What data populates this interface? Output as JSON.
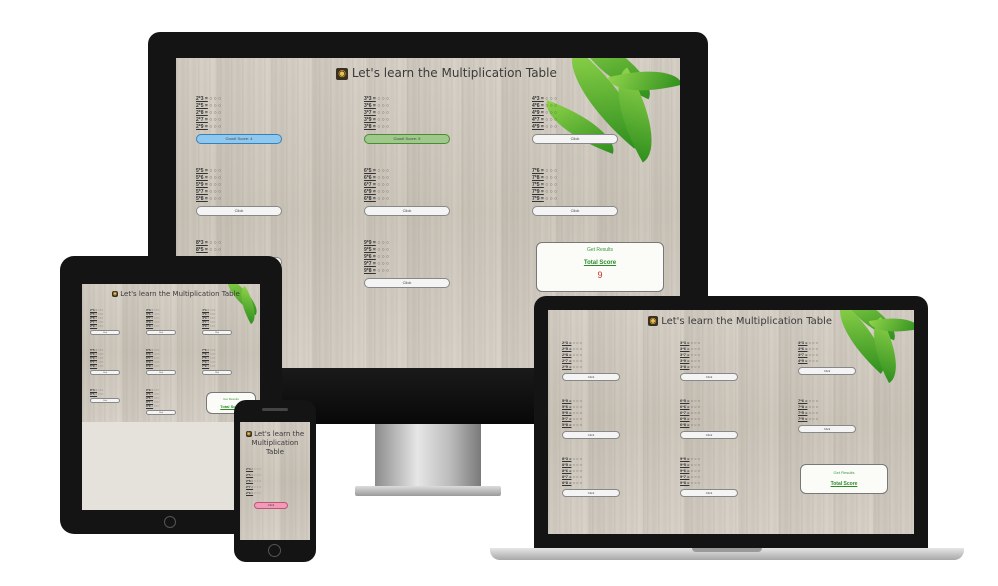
{
  "app": {
    "title": "Let's learn the Multiplication Table",
    "title_icon": "ninja-icon"
  },
  "desktop": {
    "blocks": [
      {
        "rows": [
          "2*3 =",
          "2*5 =",
          "2*8 =",
          "2*7 =",
          "2*9 ="
        ],
        "button": "Good! Score: 4"
      },
      {
        "rows": [
          "3*3 =",
          "3*6 =",
          "3*7 =",
          "3*9 =",
          "3*8 ="
        ],
        "button": "Good! Score: 5"
      },
      {
        "rows": [
          "4*3 =",
          "4*6 =",
          "4*9 =",
          "4*7 =",
          "4*9 ="
        ],
        "button": "Click"
      },
      {
        "rows": [
          "5*5 =",
          "5*6 =",
          "5*9 =",
          "5*7 =",
          "5*8 ="
        ],
        "button": "Click"
      },
      {
        "rows": [
          "6*5 =",
          "6*6 =",
          "6*7 =",
          "6*9 =",
          "6*8 ="
        ],
        "button": "Click"
      },
      {
        "rows": [
          "7*6 =",
          "7*8 =",
          "7*5 =",
          "7*9 =",
          "7*9 ="
        ],
        "button": "Click"
      },
      {
        "rows": [
          "8*3 =",
          "8*5 ="
        ],
        "button": "Click"
      },
      {
        "rows": [
          "9*9 =",
          "9*5 =",
          "9*6 =",
          "9*7 =",
          "9*8 ="
        ],
        "button": "Click"
      }
    ],
    "results": {
      "label": "Get Results",
      "total": "Total Score",
      "score": "9"
    }
  },
  "laptop": {
    "blocks": [
      {
        "rows": [
          "2*3 =",
          "2*5 =",
          "2*8 =",
          "2*7 =",
          "2*9 ="
        ],
        "button": "Click"
      },
      {
        "rows": [
          "3*3 =",
          "3*6 =",
          "3*7 =",
          "3*9 =",
          "3*8 ="
        ],
        "button": "Click"
      },
      {
        "rows": [
          "4*3 =",
          "4*6 =",
          "4*7 =",
          "4*9 ="
        ],
        "button": "Click"
      },
      {
        "rows": [
          "5*5 =",
          "5*6 =",
          "5*9 =",
          "5*7 =",
          "5*8 ="
        ],
        "button": "Click"
      },
      {
        "rows": [
          "6*5 =",
          "6*6 =",
          "6*7 =",
          "6*9 =",
          "6*8 ="
        ],
        "button": "Click"
      },
      {
        "rows": [
          "7*6 =",
          "7*8 =",
          "7*5 =",
          "7*9 ="
        ],
        "button": "Click"
      },
      {
        "rows": [
          "8*3 =",
          "8*5 =",
          "8*6 =",
          "8*7 =",
          "8*8 ="
        ],
        "button": "Click"
      },
      {
        "rows": [
          "9*9 =",
          "9*5 =",
          "9*6 =",
          "9*7 =",
          "9*8 ="
        ],
        "button": "Click"
      }
    ],
    "results": {
      "label": "Get Results",
      "total": "Total Score"
    }
  },
  "tablet": {
    "results": {
      "label": "Get Results",
      "total": "Total Score"
    },
    "button": "Click"
  },
  "phone": {
    "title": "Let's learn the Multiplication Table",
    "button": "Click"
  },
  "colors": {
    "bezel": "#141414",
    "wood": "#d6d0c6",
    "blue_button": "#8fc8ef",
    "green_button": "#9fc98a",
    "pink_button": "#f29ab6",
    "score_red": "#c03030",
    "results_green": "#3a9a3a"
  }
}
